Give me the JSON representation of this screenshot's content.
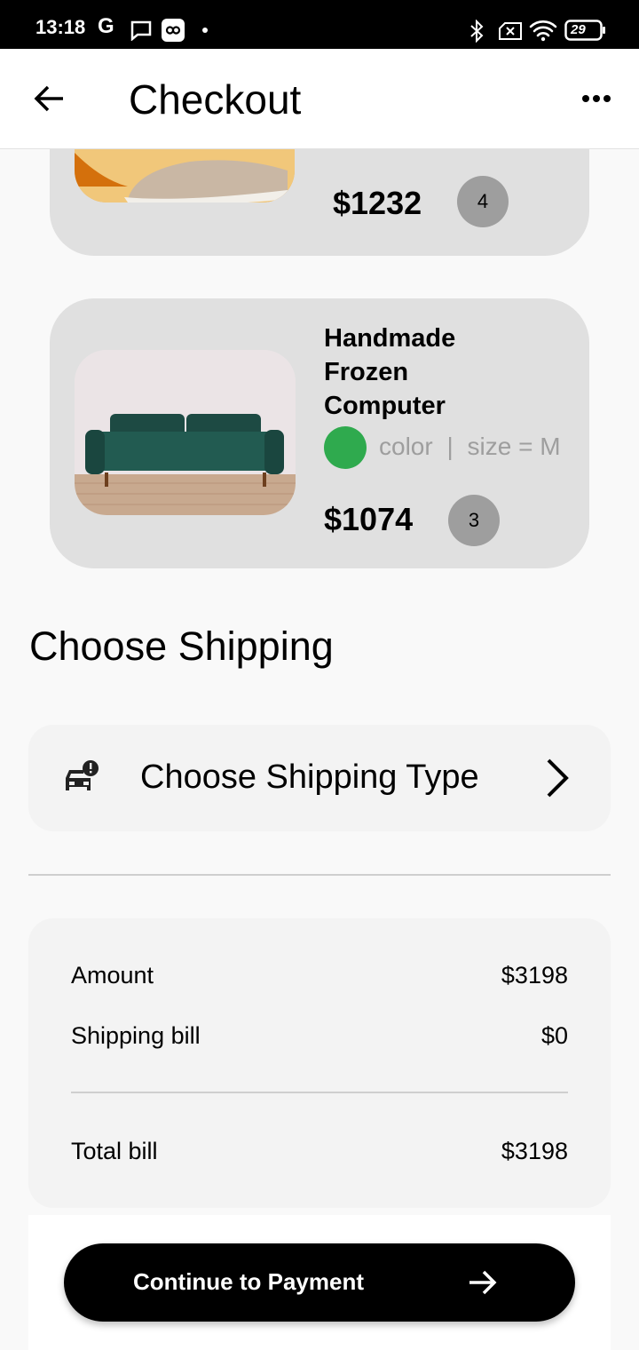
{
  "status_bar": {
    "time": "13:18",
    "g_label": "G",
    "battery": "29"
  },
  "app_bar": {
    "title": "Checkout",
    "back_icon": "arrow-left-icon",
    "more_icon": "more-horizontal-icon"
  },
  "cart_items": [
    {
      "price": "$1232",
      "quantity": "4",
      "image": "shoe-image"
    },
    {
      "title": "Handmade Frozen Computer",
      "color_swatch": "#2faa4e",
      "color_label": "color",
      "separator": "|",
      "size_label": "size = M",
      "price": "$1074",
      "quantity": "3",
      "image": "sofa-image"
    }
  ],
  "shipping": {
    "section_title": "Choose Shipping",
    "type_label": "Choose Shipping Type",
    "icon": "car-alert-icon",
    "chevron": "chevron-right-icon"
  },
  "summary": {
    "amount_label": "Amount",
    "amount_value": "$3198",
    "shipping_label": "Shipping bill",
    "shipping_value": "$0",
    "total_label": "Total bill",
    "total_value": "$3198"
  },
  "cta": {
    "label": "Continue to Payment",
    "icon": "arrow-right-icon"
  }
}
